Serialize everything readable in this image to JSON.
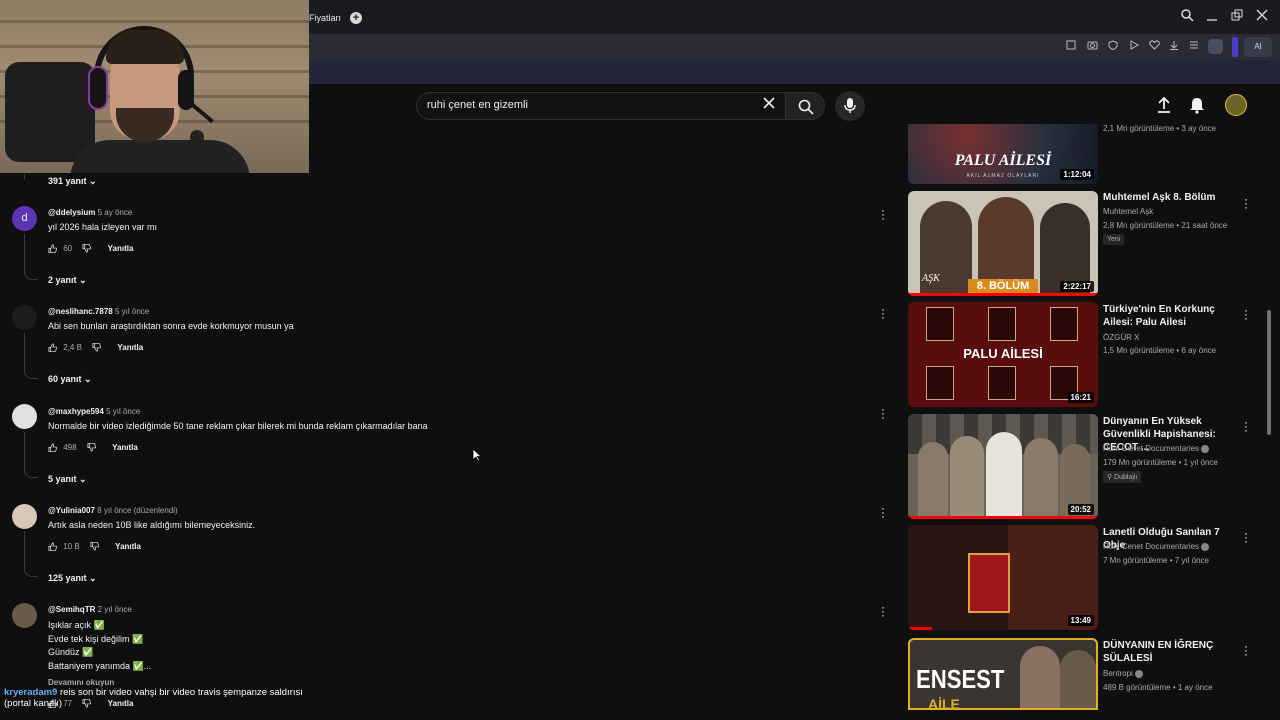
{
  "browser": {
    "tab_label": "Fiyatları",
    "ai_button": "AI"
  },
  "search": {
    "query": "ruhi çenet en gizemli"
  },
  "comments": [
    {
      "replies_label": "391 yanıt"
    },
    {
      "handle": "@ddelysium",
      "time": "5 ay önce",
      "text": [
        "yıl 2026 hala izleyen var mı"
      ],
      "likes": "60",
      "reply_label": "Yanıtla",
      "replies_label": "2 yanıt",
      "avatar_letter": "d",
      "avatar_color": "#5e35b1"
    },
    {
      "handle": "@neslihanc.7878",
      "time": "5 yıl önce",
      "text": [
        "Abi sen bunları araştırdıktan sonra evde korkmuyor musun ya"
      ],
      "likes": "2,4 B",
      "reply_label": "Yanıtla",
      "replies_label": "60 yanıt",
      "avatar_color": "#1c1c1c"
    },
    {
      "handle": "@maxhype594",
      "time": "5 yıl önce",
      "text": [
        "Normalde bir video izlediğimde 50 tane reklam çıkar bilerek mi bunda reklam çıkarmadılar bana"
      ],
      "likes": "498",
      "reply_label": "Yanıtla",
      "replies_label": "5 yanıt",
      "avatar_color": "#e0e0e0"
    },
    {
      "handle": "@Yulinia007",
      "time": "8 yıl önce (düzenlendi)",
      "text": [
        "Artık asla neden 10B like aldığımı bilemeyeceksiniz."
      ],
      "likes": "10 B",
      "reply_label": "Yanıtla",
      "replies_label": "125 yanıt",
      "avatar_color": "#d8c8b8"
    },
    {
      "handle": "@SemihqTR",
      "time": "2 yıl önce",
      "text": [
        "Işıklar açık ✅",
        "Evde tek kişi değilim ✅",
        "Gündüz ✅",
        "Battaniyem yanımda ✅..."
      ],
      "read_more": "Devamını okuyun",
      "likes": "77",
      "reply_label": "Yanıtla",
      "avatar_color": "#6a5a4a"
    }
  ],
  "videos": [
    {
      "title": "",
      "channel": "",
      "meta": "2,1 Mn görüntüleme • 3 ay önce",
      "duration": "1:12:04",
      "thumb_text": "PALU AİLESİ",
      "thumb_sub": "AKIL ALMAZ OLAYLARI",
      "thumb_color": "#2a3040"
    },
    {
      "title": "Muhtemel Aşk 8. Bölüm",
      "channel": "Muhtemel Aşk",
      "meta": "2,8 Mn görüntüleme • 21 saat önce",
      "badge": "Yeni",
      "duration": "2:22:17",
      "thumb_text": "8. BÖLÜM",
      "thumb_sub": "AŞK",
      "thumb_color": "#c9c3b8"
    },
    {
      "title": "Türkiye'nin En Korkunç Ailesi: Palu Ailesi",
      "channel": "ÖZGÜR X",
      "meta": "1,5 Mn görüntüleme • 6 ay önce",
      "duration": "16:21",
      "thumb_text": "PALU AİLESİ",
      "thumb_color": "#5a0d0d"
    },
    {
      "title": "Dünyanın En Yüksek Güvenlikli Hapishanesi: CECOT ...",
      "channel": "Ruhi Cenet Documentaries",
      "meta": "179 Mn görüntüleme • 1 yıl önce",
      "badge": "Dublajlı",
      "duration": "20:52",
      "thumb_color": "#6a6258"
    },
    {
      "title": "Lanetli Olduğu Sanılan 7 Obje",
      "channel": "Ruhi Cenet Documentaries",
      "meta": "7 Mn görüntüleme • 7 yıl önce",
      "duration": "13:49",
      "thumb_color": "#2a1512"
    },
    {
      "title": "DÜNYANIN EN İĞRENÇ SÜLALESİ",
      "channel": "Bentropi",
      "meta": "489 B görüntüleme • 1 ay önce",
      "thumb_text": "ENSEST",
      "thumb_sub": "AİLE",
      "thumb_color": "#3a3530"
    }
  ],
  "chat": {
    "user": "kryeradam9",
    "message": "reis son bir video vahşi bir video travis şempanze saldırısı",
    "line2": "(portal kanalı)"
  },
  "colors": {
    "background": "#0f0f0f",
    "accent_red": "#ff0000",
    "chat_user": "#5fb0ff"
  }
}
